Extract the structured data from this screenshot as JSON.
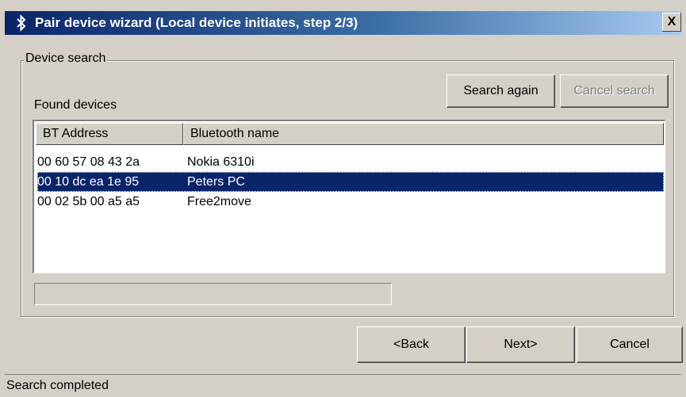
{
  "window": {
    "title": "Pair device wizard (Local device initiates, step 2/3)",
    "close_label": "X"
  },
  "device_search": {
    "group_label": "Device search",
    "search_again_label": "Search again",
    "cancel_search_label": "Cancel search",
    "found_devices_label": "Found devices",
    "columns": [
      "BT Address",
      "Bluetooth name"
    ],
    "devices": [
      {
        "address": "00 60 57 08 43 2a",
        "name": "Nokia 6310i",
        "selected": false
      },
      {
        "address": "00 10 dc ea 1e 95",
        "name": "Peters PC",
        "selected": true
      },
      {
        "address": "00 02 5b 00 a5 a5",
        "name": "Free2move",
        "selected": false
      }
    ],
    "progress_fraction": 0
  },
  "buttons": {
    "back_label": "<Back",
    "next_label": "Next>",
    "cancel_label": "Cancel"
  },
  "status": {
    "text": "Search completed"
  },
  "colors": {
    "titlebar_start": "#0a246a",
    "titlebar_end": "#a6caf0",
    "selection": "#0a246a",
    "face": "#d4d0c8"
  },
  "icons": {
    "title_icon": "bluetooth-icon"
  }
}
